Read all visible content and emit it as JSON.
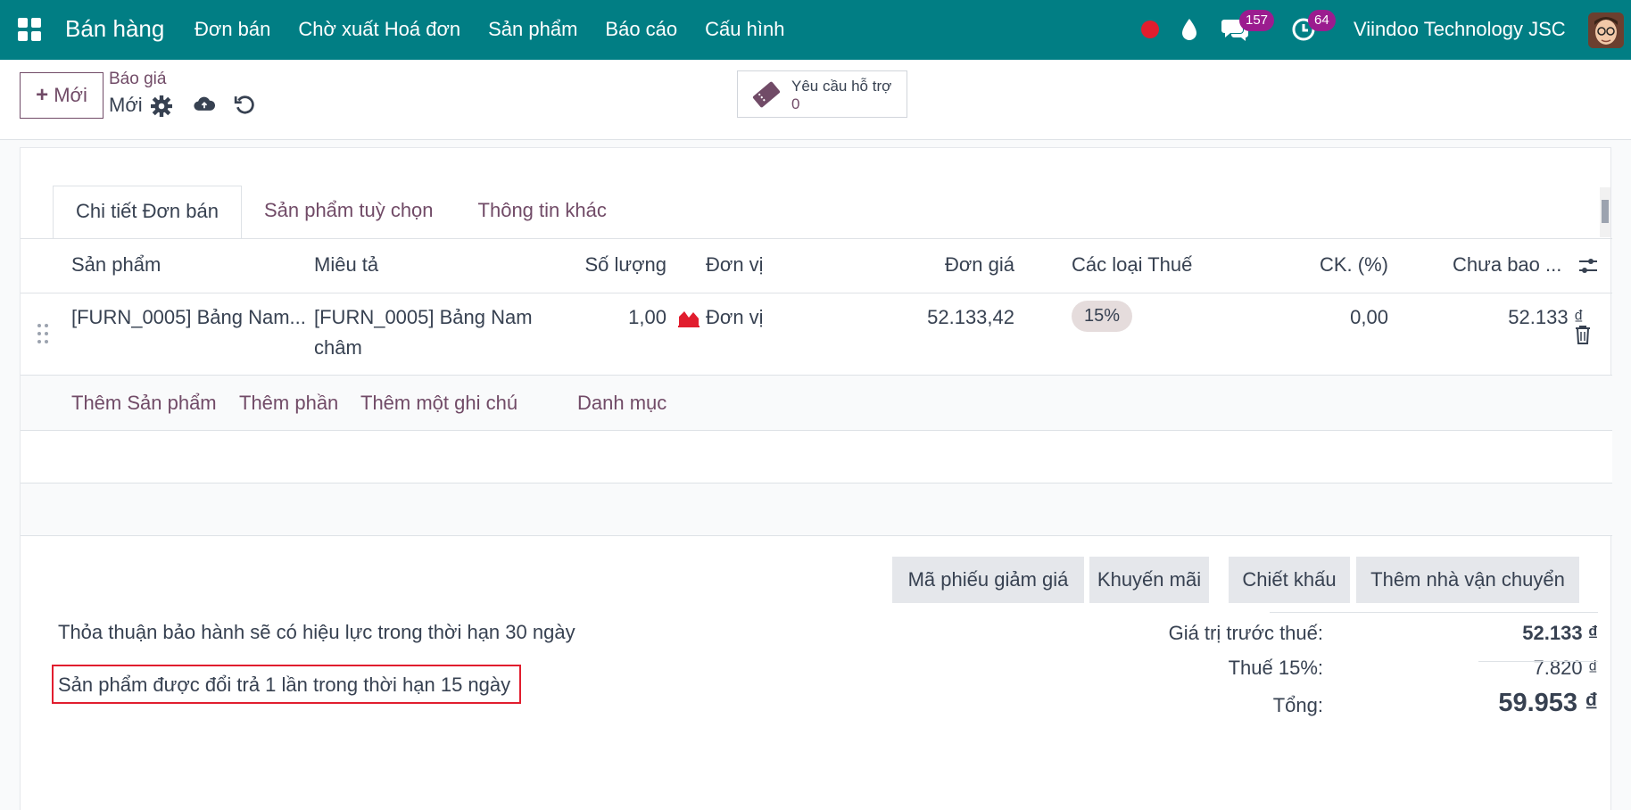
{
  "nav": {
    "app_name": "Bán hàng",
    "menu": [
      "Đơn bán",
      "Chờ xuất Hoá đơn",
      "Sản phẩm",
      "Báo cáo",
      "Cấu hình"
    ],
    "chat_count": "157",
    "activity_count": "64",
    "company": "Viindoo Technology JSC"
  },
  "control": {
    "new_label": "Mới",
    "breadcrumb_parent": "Báo giá",
    "breadcrumb_current": "Mới",
    "support_label": "Yêu cầu hỗ trợ",
    "support_count": "0"
  },
  "tabs": [
    "Chi tiết Đơn bán",
    "Sản phẩm tuỳ chọn",
    "Thông tin khác"
  ],
  "table": {
    "headers": [
      "Sản phẩm",
      "Miêu tả",
      "Số lượng",
      "Đơn vị",
      "Đơn giá",
      "Các loại Thuế",
      "CK. (%)",
      "Chưa bao ..."
    ],
    "row": {
      "product": "[FURN_0005] Bảng Nam...",
      "description_line1": "[FURN_0005] Bảng Nam",
      "description_line2": "châm",
      "quantity": "1,00",
      "uom": "Đơn vị",
      "unit_price": "52.133,42",
      "tax": "15%",
      "discount": "0,00",
      "subtotal": "52.133 ₫"
    },
    "add_links": [
      "Thêm Sản phẩm",
      "Thêm phần",
      "Thêm một ghi chú",
      "Danh mục"
    ]
  },
  "actions": [
    "Mã phiếu giảm giá",
    "Khuyến mãi",
    "Chiết khấu",
    "Thêm nhà vận chuyển"
  ],
  "notes": {
    "line1": "Thỏa thuận bảo hành sẽ có hiệu lực trong thời hạn 30 ngày",
    "line2": "Sản phẩm được đổi trả 1 lần trong thời hạn 15 ngày"
  },
  "totals": {
    "untaxed_label": "Giá trị trước thuế:",
    "untaxed_value": "52.133 ₫",
    "tax_label": "Thuế 15%:",
    "tax_value": "7.820 ₫",
    "total_label": "Tổng:",
    "total_value": "59.953 ₫"
  },
  "colors": {
    "nav_bg": "#017e84",
    "accent": "#714b67",
    "badge": "#9b1c8f",
    "highlight": "#e11d2e"
  }
}
